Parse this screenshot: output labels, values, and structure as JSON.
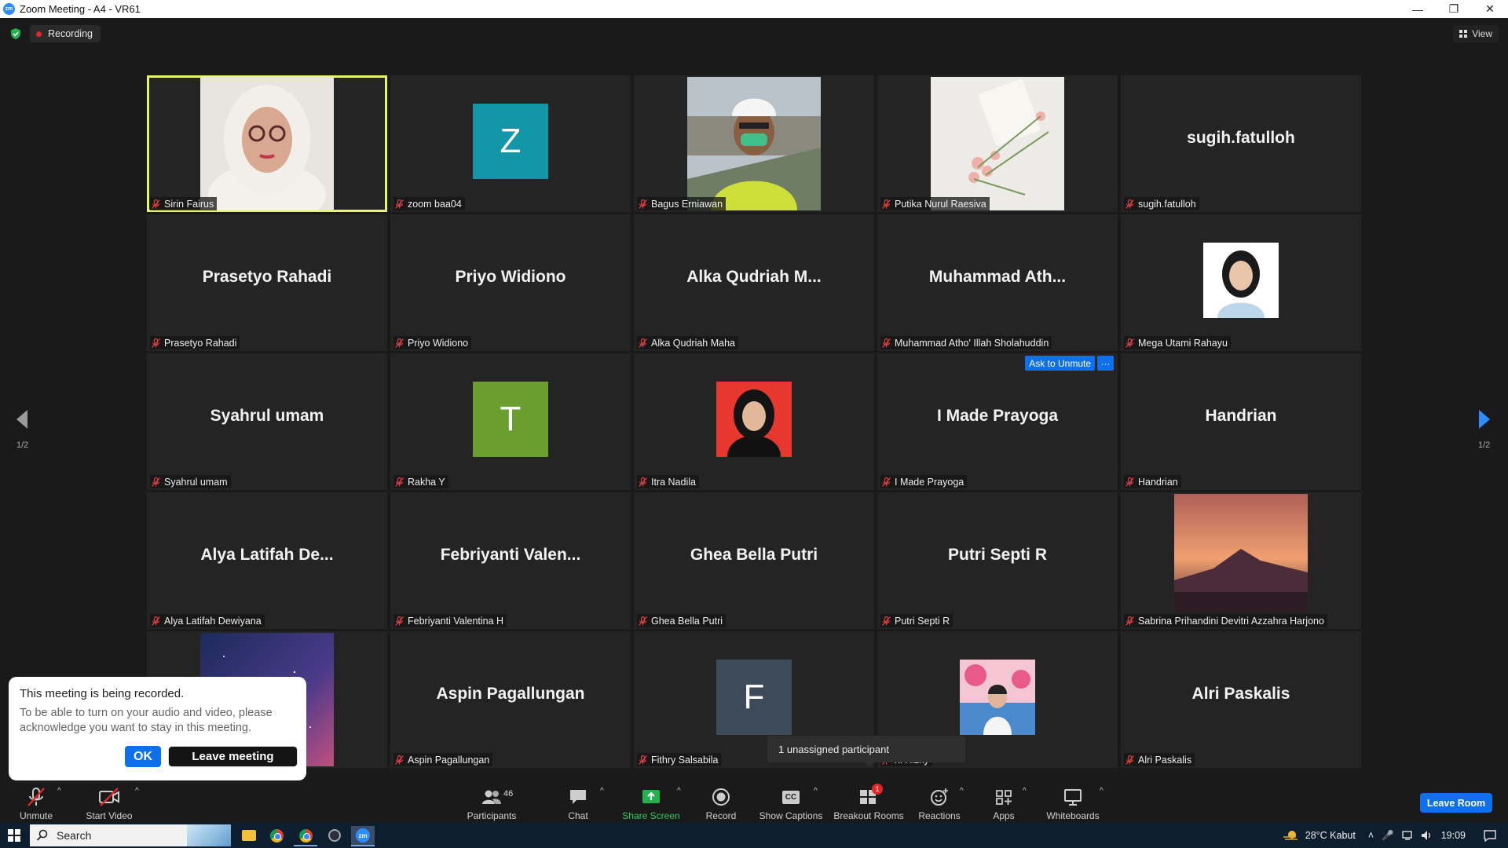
{
  "window": {
    "title": "Zoom Meeting - A4 - VR61",
    "app_icon_text": "zm"
  },
  "topbar": {
    "recording_label": "Recording",
    "view_label": "View"
  },
  "gallery": {
    "page_left": "1/2",
    "page_right": "1/2",
    "tiles": [
      {
        "label": "Sirin Fairus",
        "bigname": "",
        "kind": "photo-face"
      },
      {
        "label": "zoom baa04",
        "bigname": "",
        "kind": "letter",
        "letter": "Z",
        "color": "#1296a8"
      },
      {
        "label": "Bagus Erniawan",
        "bigname": "",
        "kind": "photo-worker"
      },
      {
        "label": "Putika Nurul Raesiva",
        "bigname": "",
        "kind": "photo-flowers"
      },
      {
        "label": "sugih.fatulloh",
        "bigname": "sugih.fatulloh",
        "kind": "name"
      },
      {
        "label": "Prasetyo Rahadi",
        "bigname": "Prasetyo Rahadi",
        "kind": "name"
      },
      {
        "label": "Priyo Widiono",
        "bigname": "Priyo Widiono",
        "kind": "name"
      },
      {
        "label": "Alka Qudriah Maha",
        "bigname": "Alka  Qudriah  M...",
        "kind": "name"
      },
      {
        "label": "Muhammad Atho' Illah Sholahuddin",
        "bigname": "Muhammad  Ath...",
        "kind": "name"
      },
      {
        "label": "Mega Utami Rahayu",
        "bigname": "",
        "kind": "photo-hijab-blue"
      },
      {
        "label": "Syahrul umam",
        "bigname": "Syahrul umam",
        "kind": "name"
      },
      {
        "label": "Rakha Y",
        "bigname": "",
        "kind": "letter",
        "letter": "T",
        "color": "#6a9e2e"
      },
      {
        "label": "Itra Nadila",
        "bigname": "",
        "kind": "photo-hijab-red"
      },
      {
        "label": "I Made Prayoga",
        "bigname": "I Made Prayoga",
        "kind": "name",
        "ask_unmute": "Ask to Unmute",
        "more": "···"
      },
      {
        "label": "Handrian",
        "bigname": "Handrian",
        "kind": "name"
      },
      {
        "label": "Alya Latifah Dewiyana",
        "bigname": "Alya  Latifah  De...",
        "kind": "name"
      },
      {
        "label": "Febriyanti Valentina H",
        "bigname": "Febriyanti  Valen...",
        "kind": "name"
      },
      {
        "label": "Ghea Bella Putri",
        "bigname": "Ghea Bella Putri",
        "kind": "name"
      },
      {
        "label": "Putri Septi R",
        "bigname": "Putri Septi R",
        "kind": "name"
      },
      {
        "label": "Sabrina Prihandini Devitri Azzahra Harjono",
        "bigname": "",
        "kind": "photo-sunset"
      },
      {
        "label": "",
        "bigname": "",
        "kind": "photo-galaxy"
      },
      {
        "label": "Aspin Pagallungan",
        "bigname": "Aspin Pagallungan",
        "kind": "name"
      },
      {
        "label": "Fithry Salsabila",
        "bigname": "",
        "kind": "letter",
        "letter": "F",
        "color": "#3d4a5a"
      },
      {
        "label": "ni Rizky",
        "bigname": "",
        "kind": "photo-pink"
      },
      {
        "label": "Alri Paskalis",
        "bigname": "Alri Paskalis",
        "kind": "name"
      }
    ]
  },
  "notice": {
    "title": "This meeting is being recorded.",
    "body": "To be able to turn on your audio and video, please acknowledge you want to stay in this meeting.",
    "ok_label": "OK",
    "leave_label": "Leave meeting"
  },
  "tooltip": {
    "text": "1 unassigned participant"
  },
  "toolbar": {
    "unmute": "Unmute",
    "start_video": "Start Video",
    "participants": "Participants",
    "participants_count": "46",
    "chat": "Chat",
    "share_screen": "Share Screen",
    "record": "Record",
    "captions": "Show Captions",
    "captions_icon_text": "CC",
    "breakout": "Breakout Rooms",
    "breakout_badge": "1",
    "reactions": "Reactions",
    "apps": "Apps",
    "whiteboards": "Whiteboards",
    "leave_room": "Leave Room",
    "caret": "^"
  },
  "taskbar": {
    "search_placeholder": "Search",
    "weather": "28°C  Kabut",
    "time": "19:09"
  },
  "colors": {
    "accent": "#0e71eb",
    "active_speaker": "#e7f56a",
    "recording_dot": "#e02828"
  }
}
